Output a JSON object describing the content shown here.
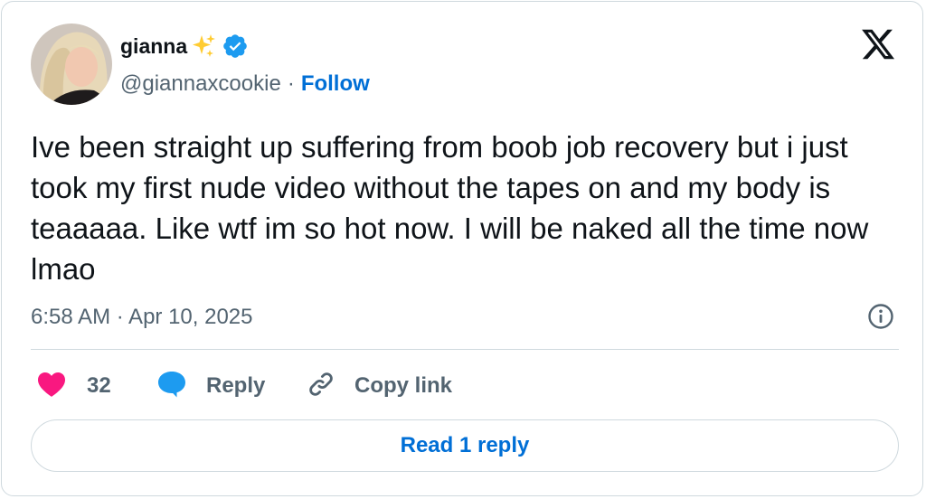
{
  "author": {
    "name": "gianna",
    "handle": "@giannaxcookie",
    "separator": "·",
    "follow_label": "Follow",
    "verified": true
  },
  "tweet": {
    "text": "Ive been straight up suffering from boob job recovery but i just took my first nude video without the tapes on and my body is teaaaaa. Like wtf im so hot now. I will be naked all the time now lmao",
    "timestamp": "6:58 AM · Apr 10, 2025"
  },
  "actions": {
    "like_count": "32",
    "reply_label": "Reply",
    "copy_link_label": "Copy link"
  },
  "read_replies_label": "Read 1 reply",
  "icons": {
    "like": "heart-icon",
    "reply": "speech-bubble-icon",
    "copy": "link-icon",
    "info": "info-icon",
    "brand": "x-logo-icon",
    "verified": "verified-badge-icon",
    "sparkle": "sparkles-icon"
  },
  "colors": {
    "like": "#f91880",
    "reply_icon": "#1d9bf0",
    "follow": "#006fd6",
    "secondary_text": "#536471",
    "border": "#cfd9de",
    "verified": "#1d9bf0",
    "sparkle": "#ffcc33"
  }
}
